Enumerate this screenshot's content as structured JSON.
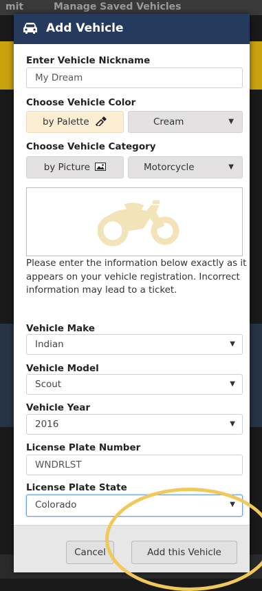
{
  "background": {
    "tab_left": "mit",
    "tab_right": "Manage Saved Vehicles"
  },
  "modal": {
    "title": "Add Vehicle",
    "title_icon": "car-icon"
  },
  "nickname": {
    "label": "Enter Vehicle Nickname",
    "value": "My Dream"
  },
  "color": {
    "label": "Choose Vehicle Color",
    "mode_button": "by Palette",
    "mode_icon": "eyedropper-icon",
    "selected": "Cream",
    "swatch_color": "#fbeed2"
  },
  "category": {
    "label": "Choose Vehicle Category",
    "mode_button": "by Picture",
    "mode_icon": "picture-icon",
    "selected": "Motorcycle",
    "preview_icon": "motorcycle-icon",
    "preview_color": "#f3e3b8"
  },
  "info_text": "Please enter the information below exactly as it appears on your vehicle registration. Incorrect information may lead to a ticket.",
  "make": {
    "label": "Vehicle Make",
    "value": "Indian"
  },
  "model": {
    "label": "Vehicle Model",
    "value": "Scout"
  },
  "year": {
    "label": "Vehicle Year",
    "value": "2016"
  },
  "plate": {
    "label": "License Plate Number",
    "value": "WNDRLST"
  },
  "plate_state": {
    "label": "License Plate State",
    "value": "Colorado"
  },
  "footer": {
    "cancel_label": "Cancel",
    "add_label": "Add this Vehicle"
  },
  "colors": {
    "header_bg": "#263a5d",
    "highlight": "#f0c95a"
  }
}
